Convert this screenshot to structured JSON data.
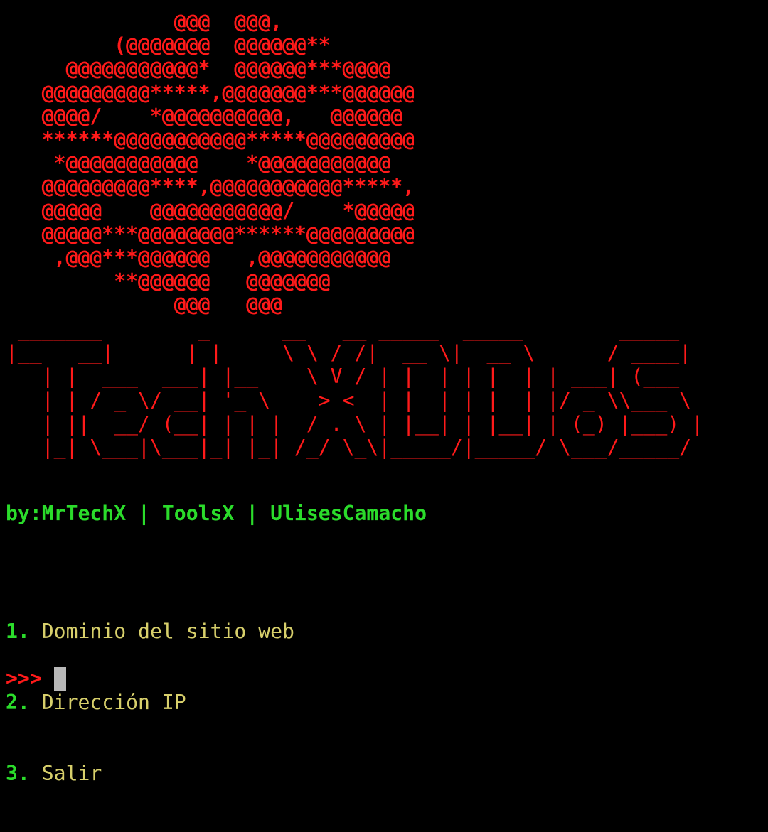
{
  "skull_art": "              @@@  @@@,\n         (@@@@@@@  @@@@@@**\n     @@@@@@@@@@@*  @@@@@@***@@@@\n   @@@@@@@@@*****,@@@@@@@***@@@@@@\n   @@@@/    *@@@@@@@@@@,   @@@@@@\n   ******@@@@@@@@@@@*****@@@@@@@@@\n    *@@@@@@@@@@@    *@@@@@@@@@@@\n   @@@@@@@@@****,@@@@@@@@@@@*****,\n   @@@@@    @@@@@@@@@@@/    *@@@@@\n   @@@@@***@@@@@@@@******@@@@@@@@@\n    ,@@@***@@@@@@   ,@@@@@@@@@@@\n         **@@@@@@   @@@@@@@\n              @@@   @@@",
  "banner_art": " _______        _      __   __ _____  _____        _____ \n|__   __|      | |     \\ \\ / /|  __ \\|  __ \\      / ____|\n   | |  ___  ___| |__    \\ V / | |  | | |  | | ___| (___  \n   | | / _ \\/ __| '_ \\    > <  | |  | | |  | |/ _ \\\\___ \\ \n   | ||  __/ (__| | | |  / . \\ | |__| | |__| | (_) |___) |\n   |_| \\___|\\___|_| |_| /_/ \\_\\|_____/|_____/ \\___/_____/ ",
  "credits": "by:MrTechX | ToolsX | UlisesCamacho",
  "menu": [
    {
      "num": "1.",
      "label": "Dominio del sitio web"
    },
    {
      "num": "2.",
      "label": "Dirección IP"
    },
    {
      "num": "3.",
      "label": "Salir"
    }
  ],
  "prompt": ">>>",
  "colors": {
    "background": "#000000",
    "art_red": "#ff1a1a",
    "green": "#2bdc2b",
    "menu_yellow": "#d7cf6b",
    "cursor": "#b8b8b8"
  }
}
